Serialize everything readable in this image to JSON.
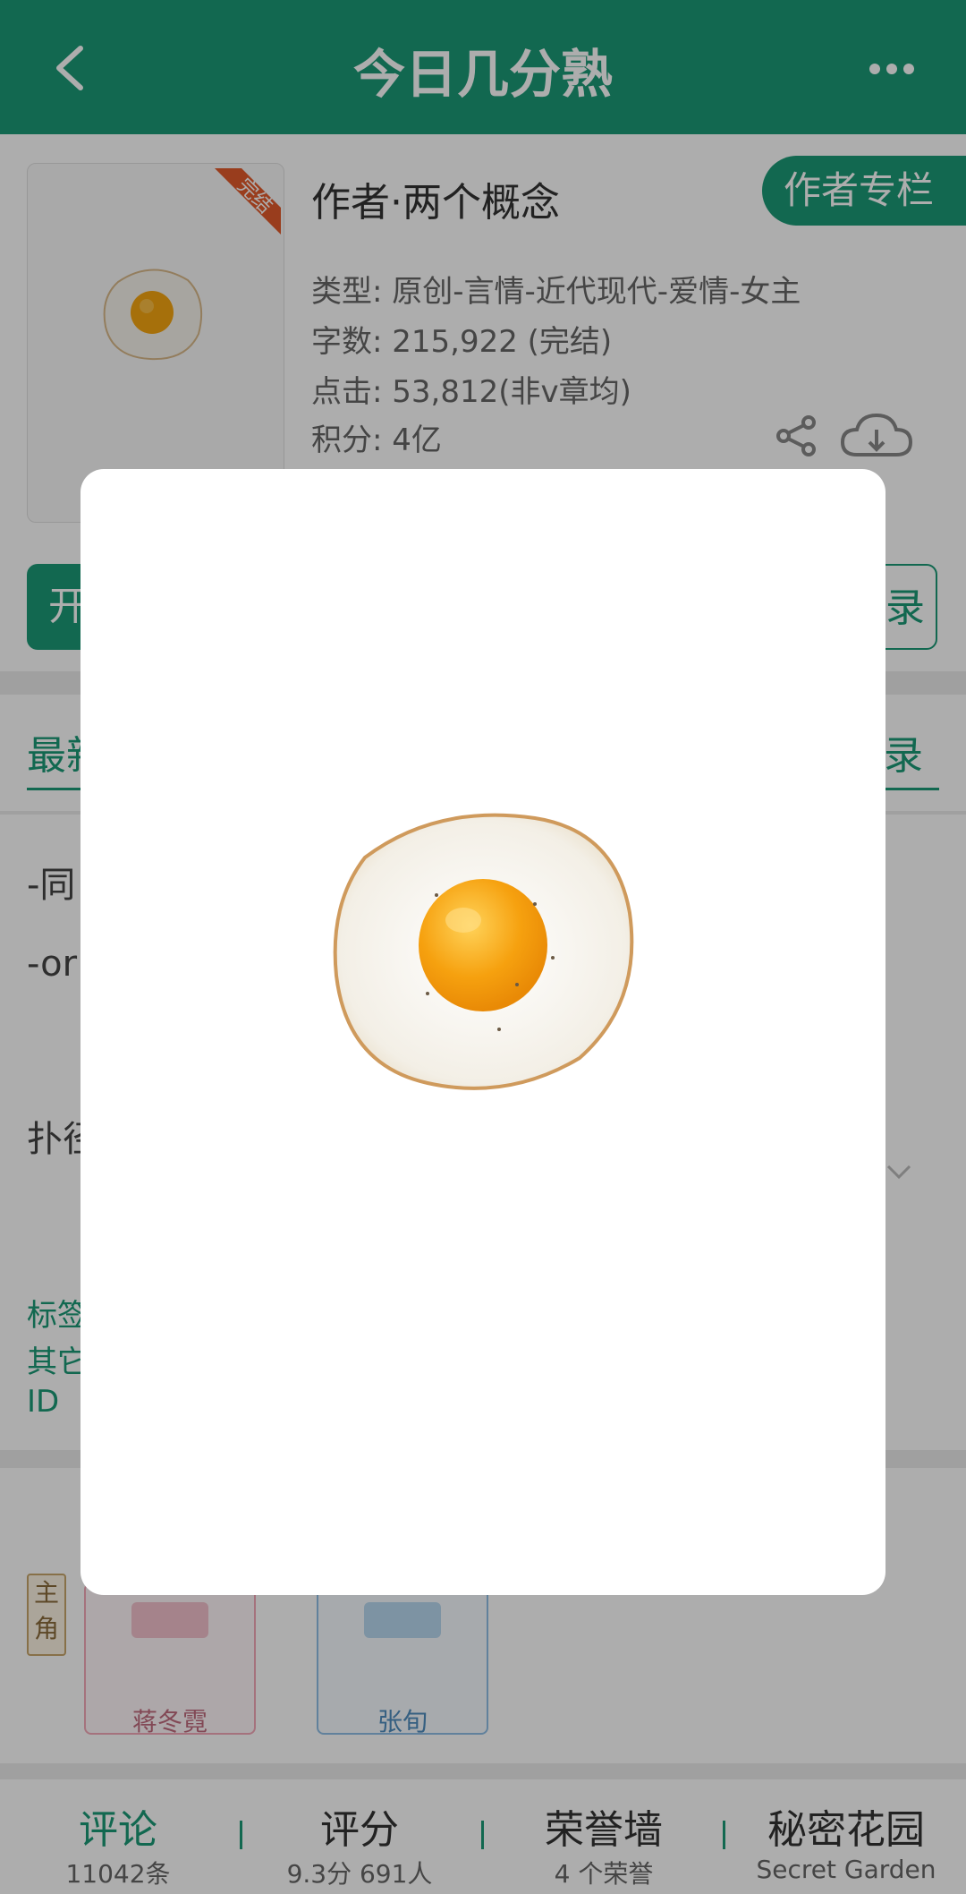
{
  "header": {
    "title": "今日几分熟"
  },
  "book": {
    "status_ribbon": "完结",
    "author": "作者·两个概念",
    "author_column_btn": "作者专栏",
    "type": "类型: 原创-言情-近代现代-爱情-女主",
    "wordcount": "字数: 215,922 (完结)",
    "clicks": "点击: 53,812(非v章均)",
    "score": "积分: 4亿"
  },
  "actions": {
    "start_partial": "开",
    "right_partial": "录"
  },
  "tabs": {
    "left_partial": "最新",
    "right_partial": "录"
  },
  "intro": {
    "line1": "-同",
    "line2": "-or",
    "line3": "扑径"
  },
  "tags": {
    "tag_partial": "标签",
    "other_partial": "其它",
    "id_partial": "ID"
  },
  "roles": {
    "badge_top": "主",
    "badge_bottom": "角",
    "items": [
      {
        "name": "蒋冬霓",
        "color": "#f4a9b8"
      },
      {
        "name": "张旬",
        "color": "#8fbfe6"
      }
    ]
  },
  "bottom_bar": [
    {
      "main": "评论",
      "sub": "11042条"
    },
    {
      "main": "评分",
      "sub": "9.3分 691人"
    },
    {
      "main": "荣誉墙",
      "sub": "4 个荣誉"
    },
    {
      "main": "秘密花园",
      "sub": "Secret Garden"
    }
  ],
  "colors": {
    "accent": "#1b9a76",
    "ribbon": "#e25a2b"
  }
}
